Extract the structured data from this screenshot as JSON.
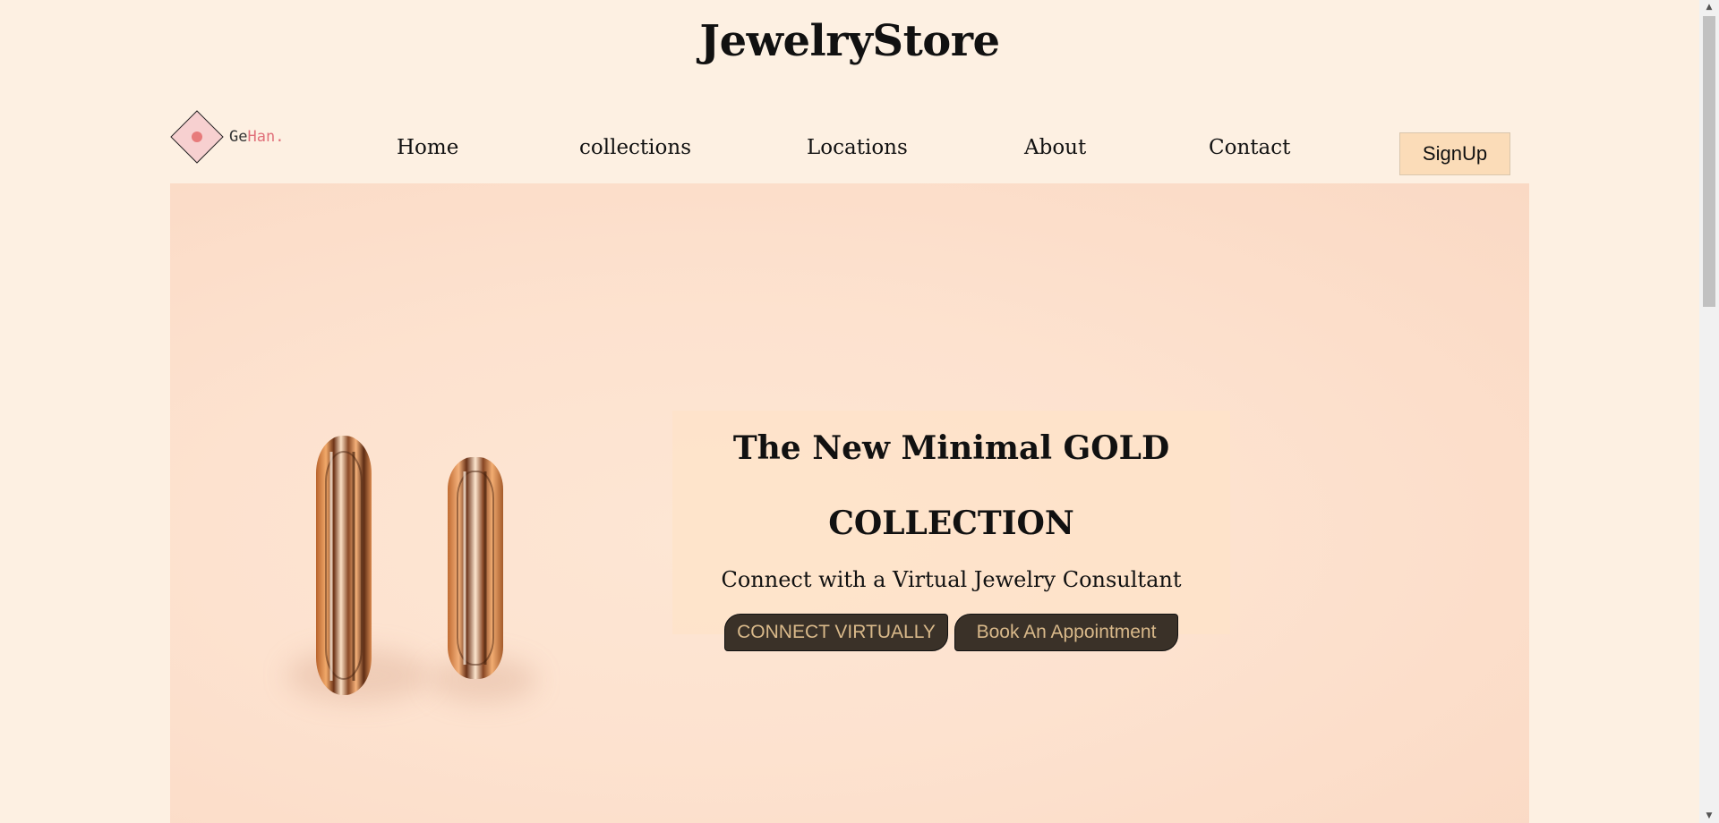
{
  "site": {
    "title": "JewelryStore"
  },
  "logo": {
    "prefix": "Ge",
    "accent": "Han",
    "suffix": "."
  },
  "nav": {
    "items": [
      {
        "label": "Home"
      },
      {
        "label": "collections"
      },
      {
        "label": "Locations"
      },
      {
        "label": "About"
      },
      {
        "label": "Contact"
      }
    ],
    "signup_label": "SignUp"
  },
  "hero": {
    "heading_line1": "The New Minimal GOLD",
    "heading_line2": "COLLECTION",
    "subheading": "Connect with a Virtual Jewelry Consultant",
    "buttons": {
      "connect_label": "CONNECT VIRTUALLY",
      "appointment_label": "Book An Appointment"
    }
  },
  "colors": {
    "page_background": "#fdf0e2",
    "signup_background": "#fbdcb8",
    "cta_background": "#3a3128",
    "cta_text": "#d9b98a",
    "logo_accent": "#e0707a"
  },
  "icons": {
    "logo_mark": "diamond-dot-icon",
    "scroll_up": "triangle-up-icon",
    "scroll_down": "triangle-down-icon"
  }
}
